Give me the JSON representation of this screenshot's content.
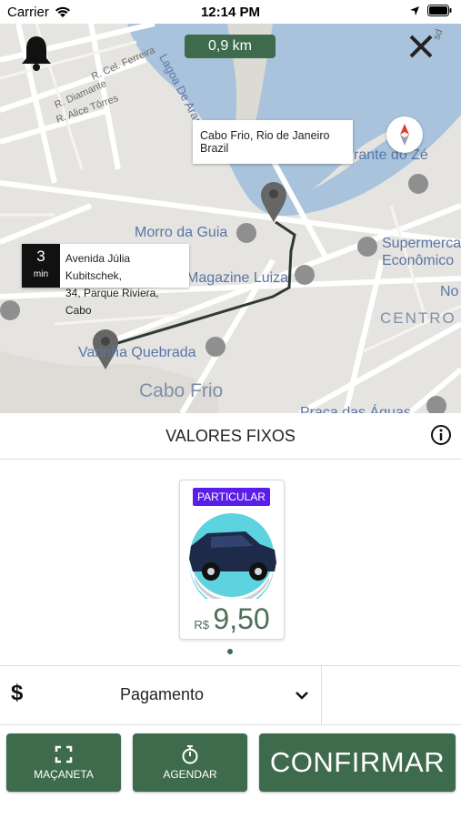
{
  "status": {
    "carrier": "Carrier",
    "time": "12:14 PM"
  },
  "map": {
    "distance": "0,9 km",
    "destination_popup": "Cabo Frio, Rio de Janeiro Brazil",
    "origin_popup": {
      "eta_value": "3",
      "eta_unit": "min",
      "address_line1": "Avenida Júlia Kubitschek,",
      "address_line2": "34, Parque Riviera, Cabo"
    },
    "labels": {
      "r_cel_ferreira": "R. Cel. Ferreira",
      "r_diamante": "R. Diamante",
      "r_alice_torres": "R. Alice Tôrres",
      "lagoa": "Lagoa De Araruama",
      "rante_do_ze": "rante do Zé",
      "morro_da_guia": "Morro da Guia",
      "supermercado": "Supermerca",
      "economico": "Econômico",
      "magazine_luiza": "Magazine Luiza",
      "no": "No",
      "centro": "CENTRO",
      "varinha_quebrada": "Varinha Quebrada",
      "cabo_frio": "Cabo Frio",
      "praca_das_aguas": "Praça das Águas",
      "sd": "sd"
    }
  },
  "section": {
    "title": "VALORES FIXOS"
  },
  "card": {
    "badge": "PARTICULAR",
    "currency": "R$",
    "price": "9,50"
  },
  "payment": {
    "symbol": "$",
    "label": "Pagamento"
  },
  "buttons": {
    "macaneta": "MAÇANETA",
    "agendar": "AGENDAR",
    "confirmar": "CONFIRMAR"
  },
  "colors": {
    "primary_green": "#3f6b4d",
    "badge_purple": "#5b1ee8",
    "water": "#a9c3dc",
    "map_land": "#e5e4e0"
  }
}
